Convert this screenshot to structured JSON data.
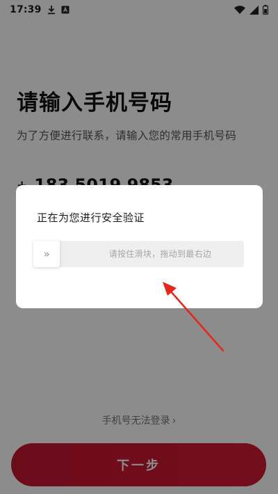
{
  "status_bar": {
    "time": "17:39",
    "icons": [
      "download-icon",
      "a-badge-icon",
      "wifi-icon",
      "signal-icon",
      "battery-icon"
    ]
  },
  "page": {
    "title": "请输入手机号码",
    "subtitle": "为了方便进行联系，请输入您的常用手机号码",
    "phone_prefix": "+",
    "phone_number": "183 5019 9853",
    "cannot_login_link": "手机号无法登录",
    "next_button": "下一步"
  },
  "dialog": {
    "title": "正在为您进行安全验证",
    "slider_hint": "请按住滑块，拖动到最右边",
    "slider_handle_glyph": "»"
  },
  "colors": {
    "primary": "#c41632",
    "overlay": "rgba(0,0,0,0.45)",
    "annotation_arrow": "#e5261f"
  }
}
